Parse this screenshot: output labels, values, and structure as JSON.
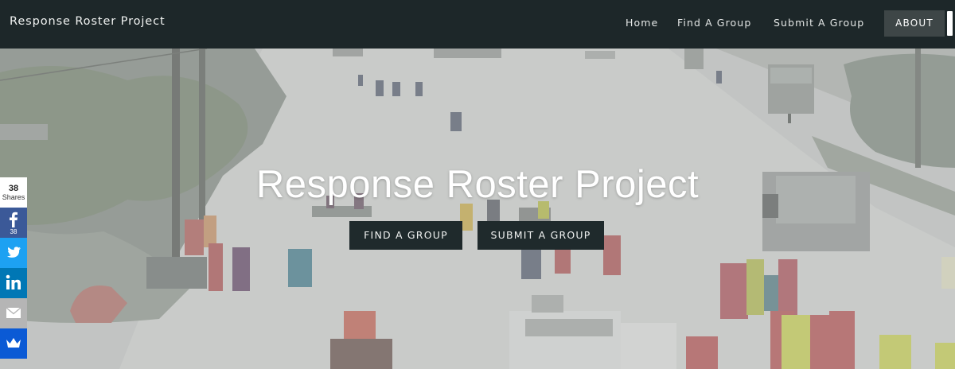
{
  "nav": {
    "brand": "Response Roster Project",
    "links": [
      "Home",
      "Find A Group",
      "Submit A Group"
    ],
    "about": "ABOUT"
  },
  "hero": {
    "title": "Response Roster Project",
    "find_button": "FIND A GROUP",
    "submit_button": "SUBMIT A GROUP"
  },
  "share": {
    "count": "38",
    "label": "Shares",
    "facebook_count": "38",
    "buttons": [
      "facebook-icon",
      "twitter-icon",
      "linkedin-icon",
      "email-icon",
      "crown-icon"
    ],
    "colors": {
      "facebook": "#3b5998",
      "twitter": "#1da1f2",
      "linkedin": "#0077b5",
      "email": "#b5b5b5",
      "crown": "#0b5ad5"
    }
  },
  "colors": {
    "navbar": "#1d2729",
    "button": "#1f2a2c",
    "about_button": "#3e4647"
  }
}
